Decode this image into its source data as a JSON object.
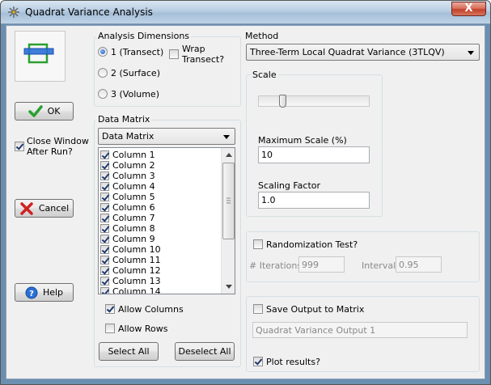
{
  "window": {
    "title": "Quadrat Variance Analysis",
    "close_glyph": "X"
  },
  "left": {
    "ok_label": "OK",
    "close_after_run_label_1": "Close Window",
    "close_after_run_label_2": "After Run?",
    "close_after_run_checked": true,
    "cancel_label": "Cancel",
    "help_label": "Help"
  },
  "dimensions": {
    "title": "Analysis Dimensions",
    "options": [
      "1 (Transect)",
      "2 (Surface)",
      "3 (Volume)"
    ],
    "selected": 0,
    "wrap_label_1": "Wrap",
    "wrap_label_2": "Transect?",
    "wrap_checked": false
  },
  "data_matrix": {
    "title": "Data Matrix",
    "selected": "Data Matrix",
    "columns": [
      "Column 1",
      "Column 2",
      "Column 3",
      "Column 4",
      "Column 5",
      "Column 6",
      "Column 7",
      "Column 8",
      "Column 9",
      "Column 10",
      "Column 11",
      "Column 12",
      "Column 13",
      "Column 14"
    ],
    "allow_columns_label": "Allow Columns",
    "allow_columns_checked": true,
    "allow_rows_label": "Allow Rows",
    "allow_rows_checked": false,
    "select_all_label": "Select All",
    "deselect_all_label": "Deselect All"
  },
  "method": {
    "title": "Method",
    "selected": "Three-Term Local Quadrat Variance (3TLQV)"
  },
  "scale": {
    "title": "Scale",
    "slider_fraction": 0.2,
    "max_scale_label": "Maximum Scale (%)",
    "max_scale_value": "10",
    "scaling_factor_label": "Scaling Factor",
    "scaling_factor_value": "1.0"
  },
  "randomization": {
    "label": "Randomization Test?",
    "checked": false,
    "iterations_label": "# Iterations",
    "iterations_value": "999",
    "interval_label": "Interval",
    "interval_value": "0.95"
  },
  "output": {
    "save_label": "Save Output to Matrix",
    "save_checked": false,
    "name_value": "Quadrat Variance Output 1",
    "plot_label": "Plot results?",
    "plot_checked": true
  },
  "colors": {
    "accent_green": "#1a8f2a",
    "accent_blue": "#2a6fd6",
    "cancel_red": "#d02020"
  }
}
